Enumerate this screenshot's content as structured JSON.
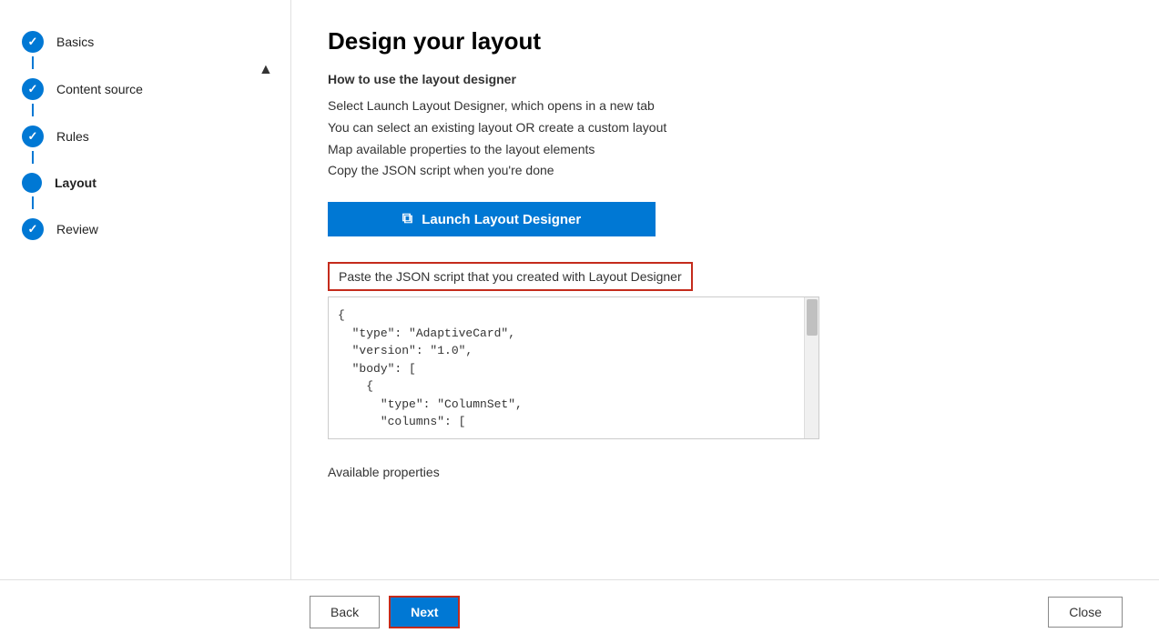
{
  "sidebar": {
    "steps": [
      {
        "id": "basics",
        "label": "Basics",
        "state": "completed"
      },
      {
        "id": "content-source",
        "label": "Content source",
        "state": "completed"
      },
      {
        "id": "rules",
        "label": "Rules",
        "state": "completed"
      },
      {
        "id": "layout",
        "label": "Layout",
        "state": "active"
      },
      {
        "id": "review",
        "label": "Review",
        "state": "completed"
      }
    ]
  },
  "main": {
    "title": "Design your layout",
    "subtitle": "How to use the layout designer",
    "instructions": [
      "Select Launch Layout Designer, which opens in a new tab",
      "You can select an existing layout OR create a custom layout",
      "Map available properties to the layout elements",
      "Copy the JSON script when you're done"
    ],
    "launch_button": "Launch Layout Designer",
    "json_label": "Paste the JSON script that you created with Layout Designer",
    "json_content": "{\n  \"type\": \"AdaptiveCard\",\n  \"version\": \"1.0\",\n  \"body\": [\n    {\n      \"type\": \"ColumnSet\",\n      \"columns\": [\n        {",
    "available_properties": "Available properties"
  },
  "footer": {
    "back_label": "Back",
    "next_label": "Next",
    "close_label": "Close"
  }
}
